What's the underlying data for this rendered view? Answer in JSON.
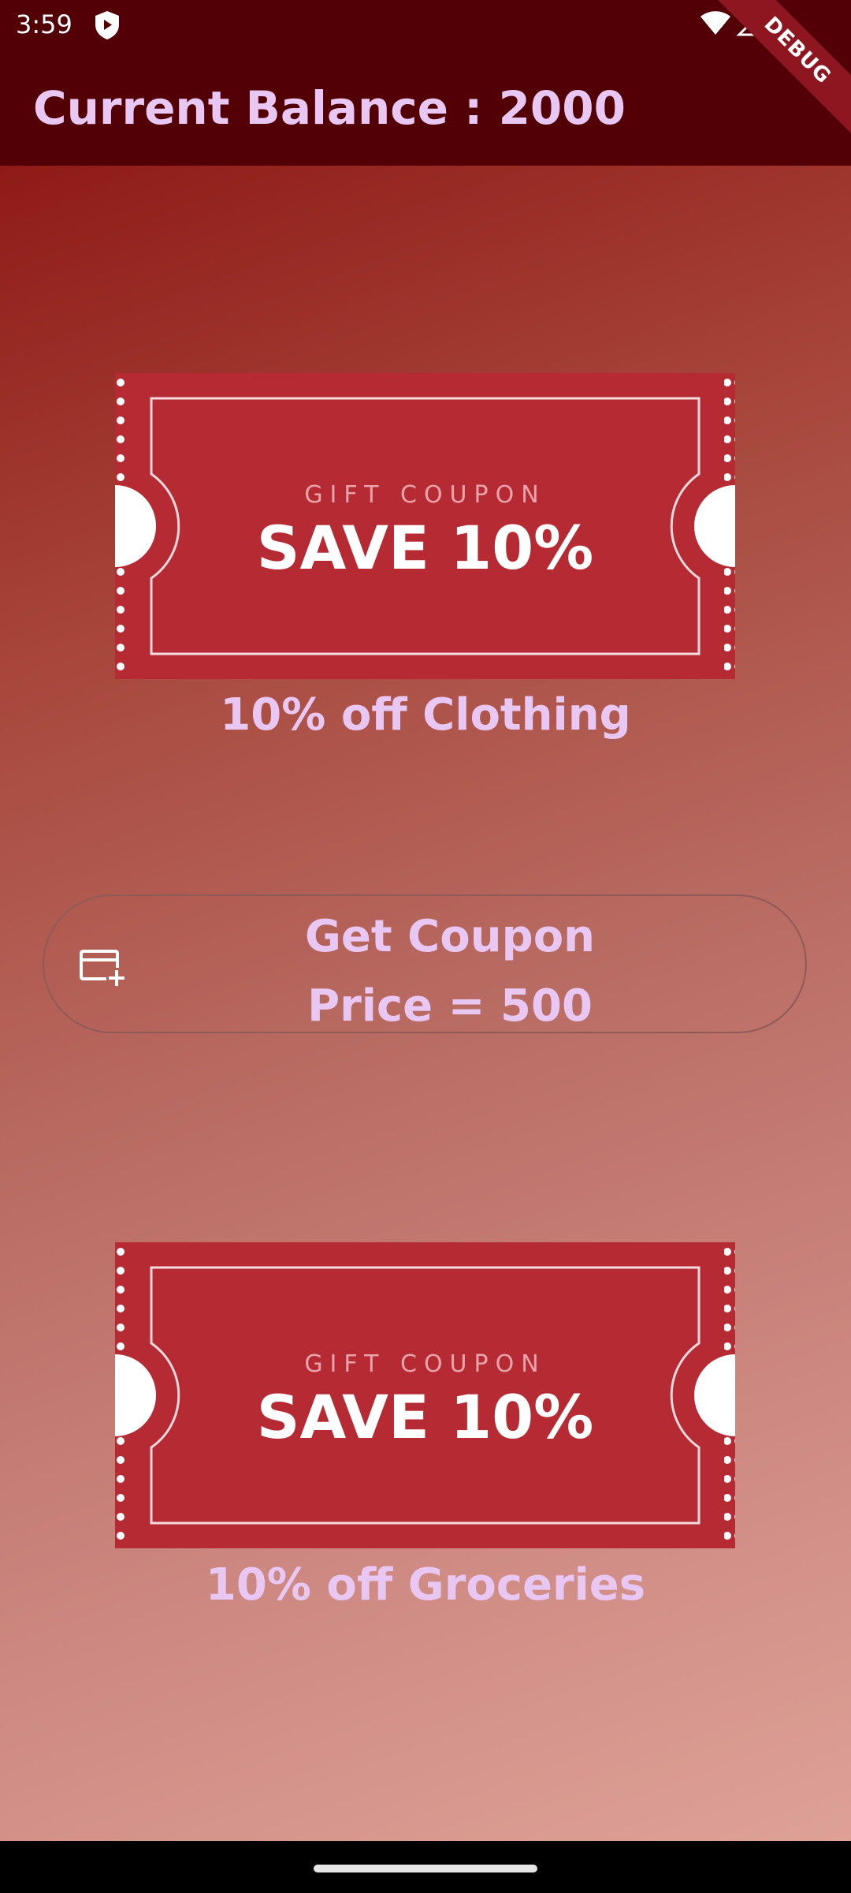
{
  "status_bar": {
    "time": "3:59",
    "icons": [
      "shield-icon",
      "wifi-icon",
      "signal-icon"
    ]
  },
  "debug_banner": "DEBUG",
  "app_bar": {
    "title": "Current Balance : 2000"
  },
  "coupons": [
    {
      "kicker": "GIFT COUPON",
      "headline": "SAVE 10%",
      "caption": "10% off Clothing"
    },
    {
      "kicker": "GIFT COUPON",
      "headline": "SAVE 10%",
      "caption": "10% off Groceries"
    }
  ],
  "get_coupon_button": {
    "line1": "Get Coupon",
    "line2": "Price = 500",
    "icon": "add-card-icon"
  },
  "colors": {
    "app_bar": "#520006",
    "text_accent": "#e8c8f2",
    "coupon_red": "#b62a34",
    "gradient_top": "#8f1a17",
    "gradient_bottom": "#dea197"
  }
}
